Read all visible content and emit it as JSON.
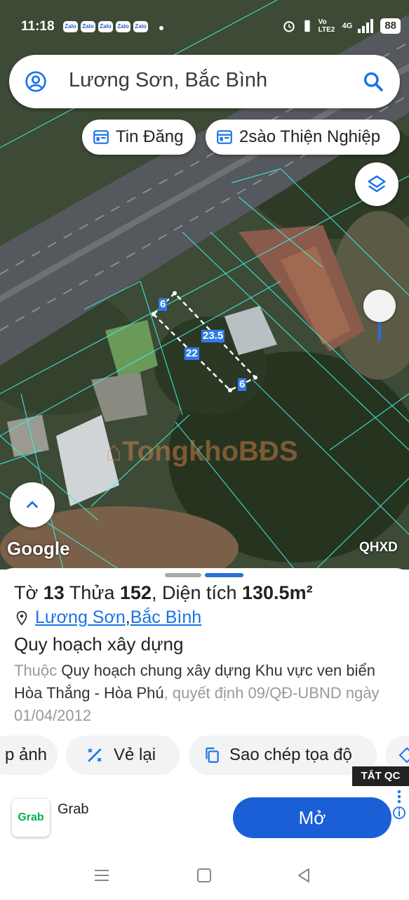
{
  "status": {
    "time": "11:18",
    "apps": [
      "Zalo",
      "Zalo",
      "Zalo",
      "Zalo",
      "Zalo"
    ],
    "network": "4G",
    "volte": "Vo LTE2",
    "battery": "88"
  },
  "search": {
    "query": "Lương Sơn, Bắc Bình"
  },
  "chips": [
    {
      "label": "Tin Đăng"
    },
    {
      "label": "2sào Thiện Nghiệp"
    }
  ],
  "map": {
    "watermark": "TongkhoBĐS",
    "google_label": "Google",
    "layer_label": "QHXD",
    "parcel_labels": {
      "top": "6",
      "right": "23.5",
      "left": "22",
      "bottom": "6"
    }
  },
  "sheet": {
    "title_prefix": "Tờ ",
    "sheet_no": "13",
    "title_mid": " Thửa ",
    "parcel_no": "152",
    "title_area_prefix": ", Diện tích ",
    "area": "130.5m²",
    "location_commune": "Lương Sơn",
    "location_sep": ", ",
    "location_district": "Bắc Bình",
    "subhead": "Quy hoạch xây dựng",
    "desc_prefix": "Thuộc ",
    "desc_plan": "Quy hoạch chung xây dựng Khu vực ven biển Hòa Thắng - Hòa Phú",
    "desc_suffix": ", quyết định 09/QĐ-UBND ngày 01/04/2012"
  },
  "actions": [
    {
      "label": "p ảnh"
    },
    {
      "label": "Vẻ lại"
    },
    {
      "label": "Sao chép tọa độ"
    }
  ],
  "ad": {
    "tag": "TẮT QC",
    "logo_text": "Grab",
    "name": "Grab",
    "button": "Mở"
  }
}
